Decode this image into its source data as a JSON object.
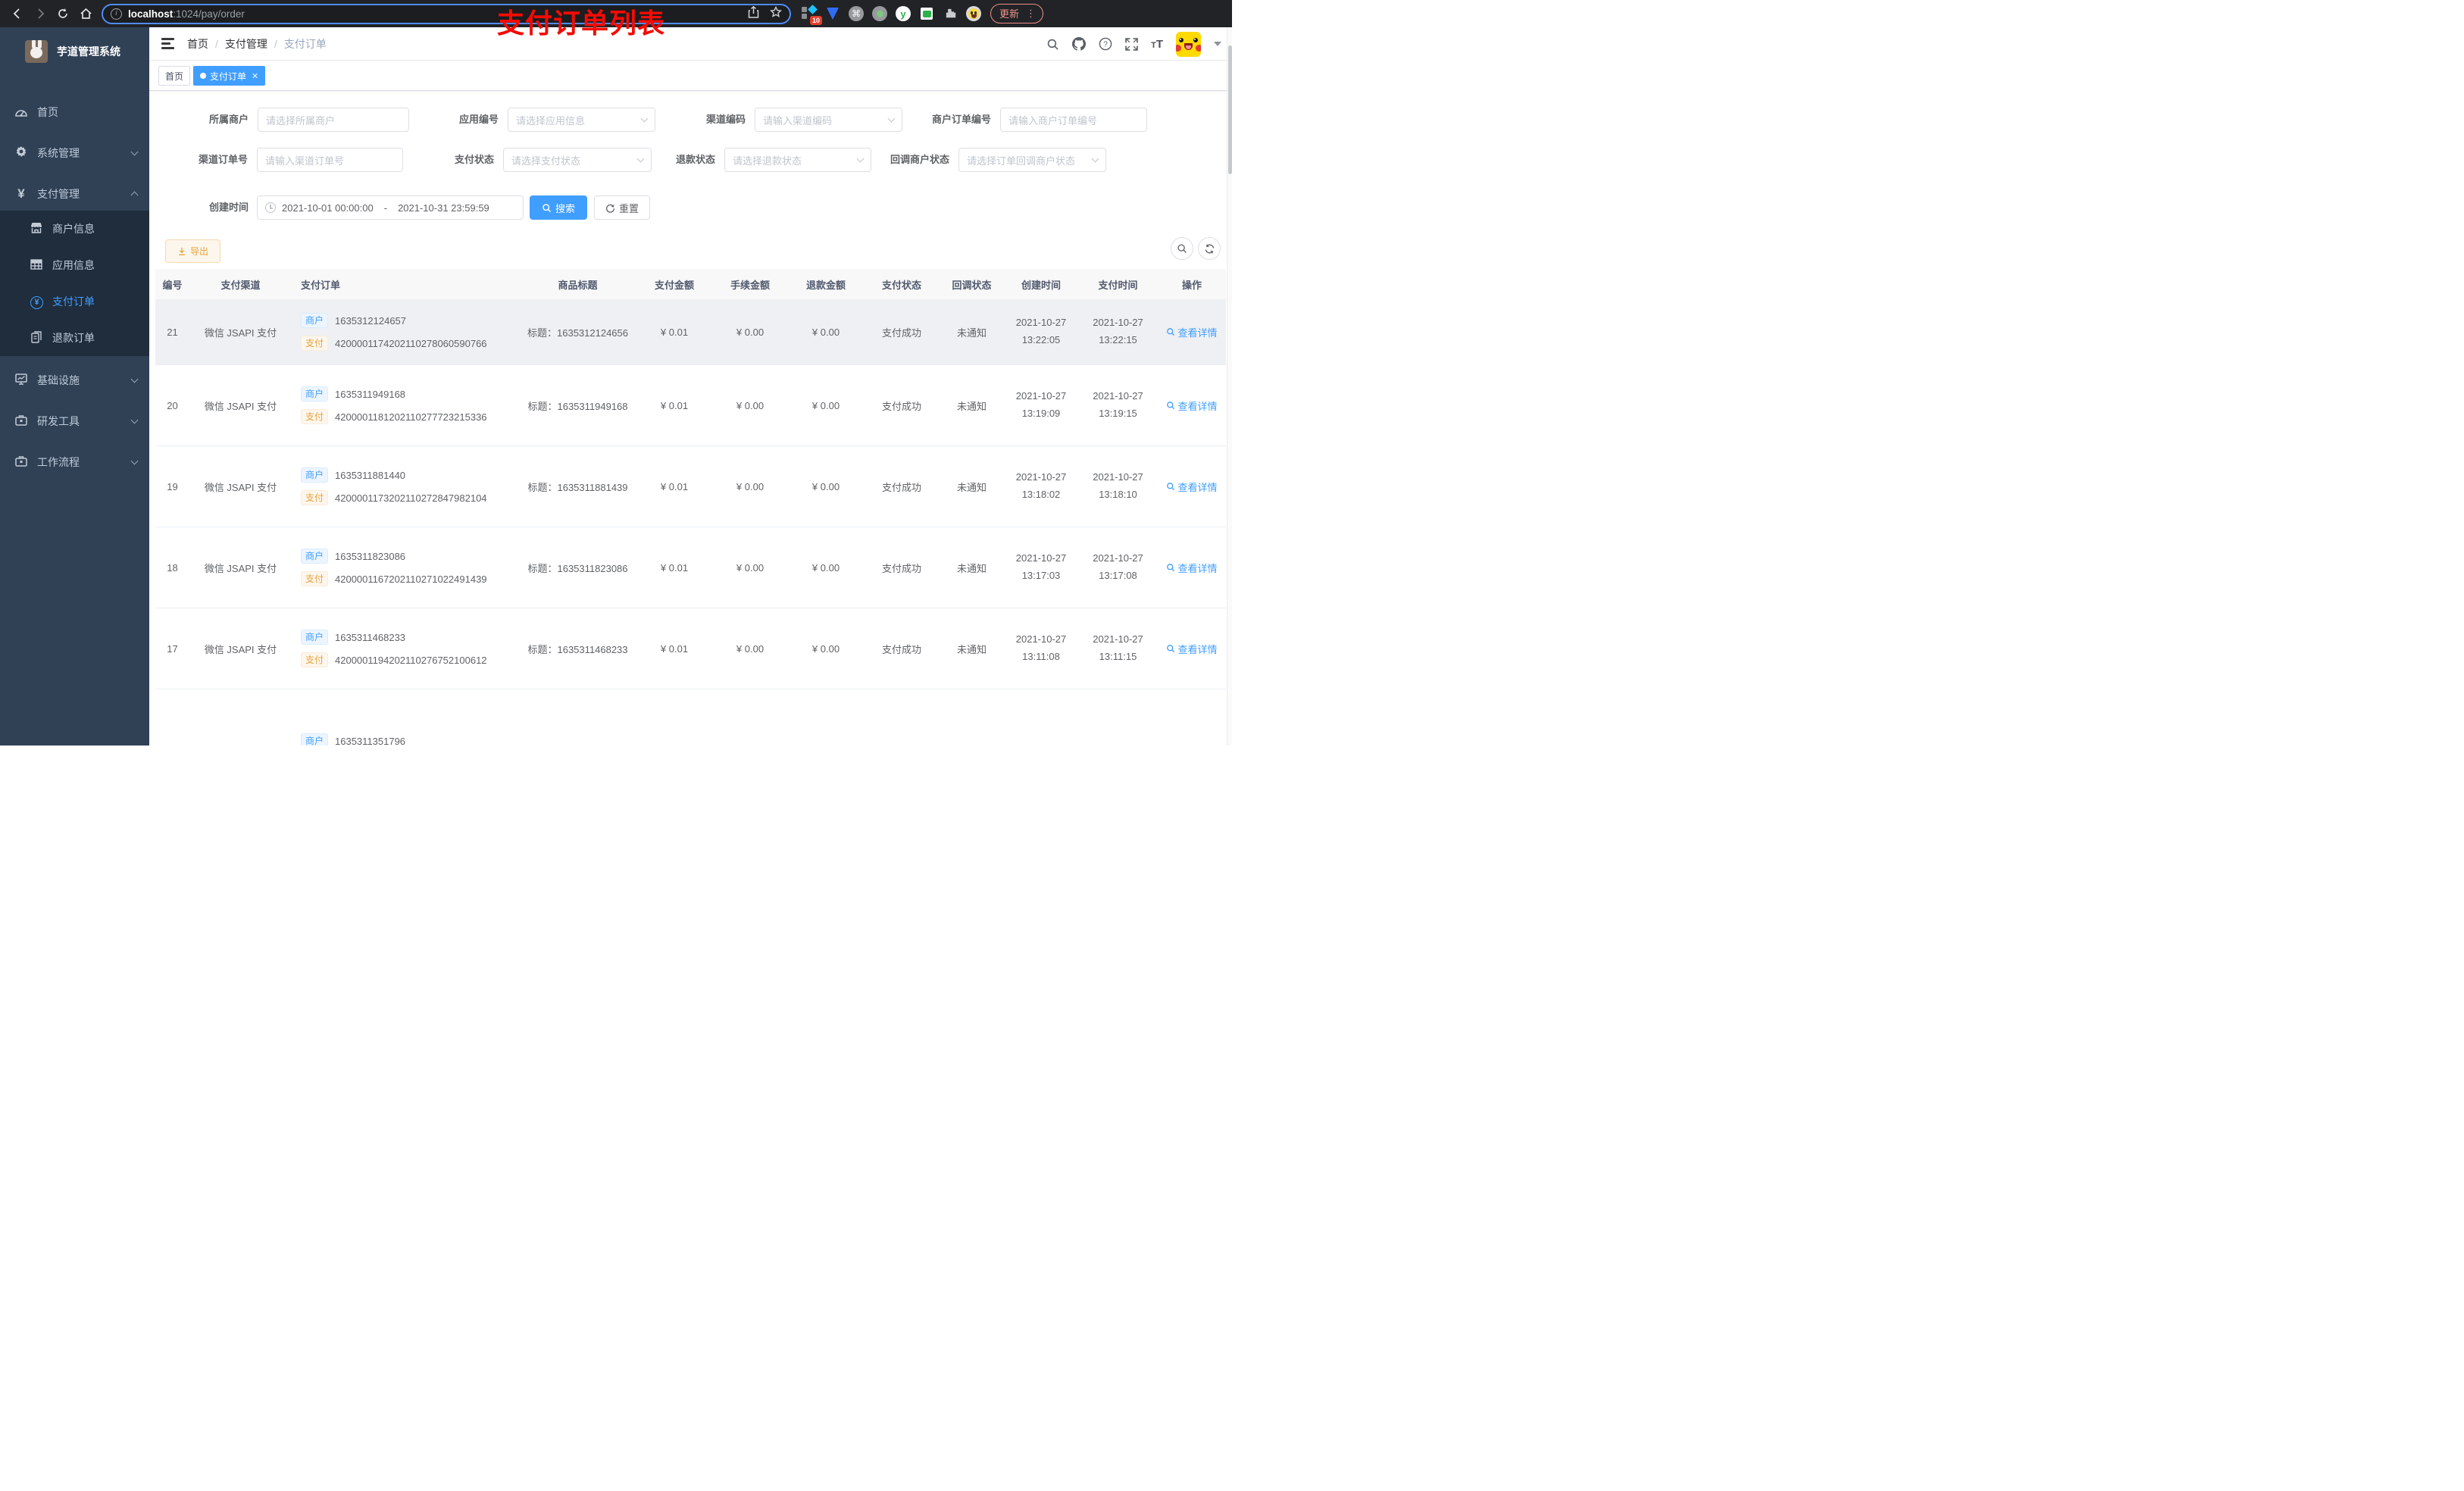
{
  "browser": {
    "url_host": "localhost",
    "url_rest": ":1024/pay/order",
    "ext_badge": "10",
    "update_label": "更新"
  },
  "sidebar": {
    "title": "芋道管理系统",
    "menu_top": [
      {
        "label": "首页",
        "icon": "dashboard-icon"
      },
      {
        "label": "系统管理",
        "icon": "gear-icon",
        "chevron": "down"
      },
      {
        "label": "支付管理",
        "icon": "yen-icon",
        "chevron": "up"
      }
    ],
    "submenu": [
      {
        "label": "商户信息",
        "icon": "shop-icon"
      },
      {
        "label": "应用信息",
        "icon": "grid-icon"
      },
      {
        "label": "支付订单",
        "icon": "yen-circle-icon",
        "active": true
      },
      {
        "label": "退款订单",
        "icon": "document-icon"
      }
    ],
    "menu_bottom": [
      {
        "label": "基础设施",
        "icon": "monitor-icon",
        "chevron": "down"
      },
      {
        "label": "研发工具",
        "icon": "toolbox-icon",
        "chevron": "down"
      },
      {
        "label": "工作流程",
        "icon": "briefcase-icon",
        "chevron": "down"
      }
    ]
  },
  "header": {
    "breadcrumb": [
      "首页",
      "支付管理",
      "支付订单"
    ],
    "overlay_title": "支付订单列表"
  },
  "tabs": {
    "items": [
      {
        "label": "首页",
        "active": false
      },
      {
        "label": "支付订单",
        "active": true
      }
    ]
  },
  "filters": {
    "row1": [
      {
        "label": "所属商户",
        "placeholder": "请选择所属商户",
        "type": "input"
      },
      {
        "label": "应用编号",
        "placeholder": "请选择应用信息",
        "type": "select"
      },
      {
        "label": "渠道编码",
        "placeholder": "请输入渠道编码",
        "type": "select"
      },
      {
        "label": "商户订单编号",
        "placeholder": "请输入商户订单编号",
        "type": "input"
      }
    ],
    "row2": [
      {
        "label": "渠道订单号",
        "placeholder": "请输入渠道订单号",
        "type": "input"
      },
      {
        "label": "支付状态",
        "placeholder": "请选择支付状态",
        "type": "select"
      },
      {
        "label": "退款状态",
        "placeholder": "请选择退款状态",
        "type": "select"
      },
      {
        "label": "回调商户状态",
        "placeholder": "请选择订单回调商户状态",
        "type": "select"
      }
    ],
    "date": {
      "label": "创建时间",
      "start": "2021-10-01 00:00:00",
      "separator": "-",
      "end": "2021-10-31 23:59:59"
    },
    "search_label": "搜索",
    "reset_label": "重置"
  },
  "toolbar": {
    "export_label": "导出"
  },
  "table": {
    "columns": [
      "编号",
      "支付渠道",
      "支付订单",
      "商品标题",
      "支付金额",
      "手续金额",
      "退款金额",
      "支付状态",
      "回调状态",
      "创建时间",
      "支付时间",
      "操作"
    ],
    "tag_merchant": "商户",
    "tag_pay": "支付",
    "action_label": "查看详情",
    "rows": [
      {
        "id": "21",
        "channel": "微信 JSAPI 支付",
        "merchant_no": "1635312124657",
        "pay_no": "4200001174202110278060590766",
        "title": "标题：1635312124656",
        "amount": "¥ 0.01",
        "fee": "¥ 0.00",
        "refund": "¥ 0.00",
        "pay_status": "支付成功",
        "notify_status": "未通知",
        "create_date": "2021-10-27",
        "create_time": "13:22:05",
        "pay_date": "2021-10-27",
        "pay_time": "13:22:15"
      },
      {
        "id": "20",
        "channel": "微信 JSAPI 支付",
        "merchant_no": "1635311949168",
        "pay_no": "4200001181202110277723215336",
        "title": "标题：1635311949168",
        "amount": "¥ 0.01",
        "fee": "¥ 0.00",
        "refund": "¥ 0.00",
        "pay_status": "支付成功",
        "notify_status": "未通知",
        "create_date": "2021-10-27",
        "create_time": "13:19:09",
        "pay_date": "2021-10-27",
        "pay_time": "13:19:15"
      },
      {
        "id": "19",
        "channel": "微信 JSAPI 支付",
        "merchant_no": "1635311881440",
        "pay_no": "4200001173202110272847982104",
        "title": "标题：1635311881439",
        "amount": "¥ 0.01",
        "fee": "¥ 0.00",
        "refund": "¥ 0.00",
        "pay_status": "支付成功",
        "notify_status": "未通知",
        "create_date": "2021-10-27",
        "create_time": "13:18:02",
        "pay_date": "2021-10-27",
        "pay_time": "13:18:10"
      },
      {
        "id": "18",
        "channel": "微信 JSAPI 支付",
        "merchant_no": "1635311823086",
        "pay_no": "4200001167202110271022491439",
        "title": "标题：1635311823086",
        "amount": "¥ 0.01",
        "fee": "¥ 0.00",
        "refund": "¥ 0.00",
        "pay_status": "支付成功",
        "notify_status": "未通知",
        "create_date": "2021-10-27",
        "create_time": "13:17:03",
        "pay_date": "2021-10-27",
        "pay_time": "13:17:08"
      },
      {
        "id": "17",
        "channel": "微信 JSAPI 支付",
        "merchant_no": "1635311468233",
        "pay_no": "4200001194202110276752100612",
        "title": "标题：1635311468233",
        "amount": "¥ 0.01",
        "fee": "¥ 0.00",
        "refund": "¥ 0.00",
        "pay_status": "支付成功",
        "notify_status": "未通知",
        "create_date": "2021-10-27",
        "create_time": "13:11:08",
        "pay_date": "2021-10-27",
        "pay_time": "13:11:15"
      }
    ],
    "partial_row": {
      "merchant_no": "1635311351796"
    }
  }
}
